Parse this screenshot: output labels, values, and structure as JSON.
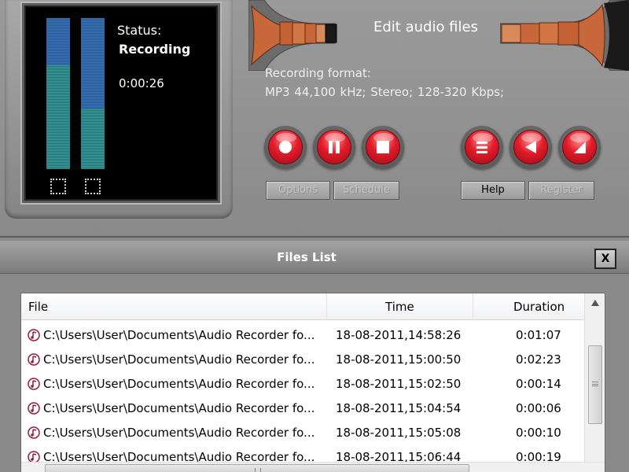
{
  "display": {
    "status_label": "Status:",
    "status_value": "Recording",
    "elapsed_time": "0:00:26",
    "vu_left_level": 0.69,
    "vu_right_level": 0.4
  },
  "header": {
    "title": "Edit audio files",
    "format_label": "Recording format:",
    "format_value": "MP3 44,100 kHz; Stereo;  128-320 Kbps;"
  },
  "transport": {
    "record_icon": "record-icon",
    "pause_icon": "pause-icon",
    "stop_icon": "stop-icon",
    "menu_icon": "menu-icon",
    "play_icon": "play-icon",
    "volume_icon": "volume-icon"
  },
  "buttons": {
    "options": "Options",
    "schedule": "Schedule",
    "help": "Help",
    "register": "Register"
  },
  "files_list": {
    "title": "Files List",
    "close_label": "X",
    "columns": {
      "file": "File",
      "time": "Time",
      "duration": "Duration"
    },
    "rows": [
      {
        "file": "C:\\Users\\User\\Documents\\Audio Recorder fo...",
        "time": "18-08-2011,14:58:26",
        "duration": "0:01:07"
      },
      {
        "file": "C:\\Users\\User\\Documents\\Audio Recorder fo...",
        "time": "18-08-2011,15:00:50",
        "duration": "0:02:23"
      },
      {
        "file": "C:\\Users\\User\\Documents\\Audio Recorder fo...",
        "time": "18-08-2011,15:02:50",
        "duration": "0:00:14"
      },
      {
        "file": "C:\\Users\\User\\Documents\\Audio Recorder fo...",
        "time": "18-08-2011,15:04:54",
        "duration": "0:00:06"
      },
      {
        "file": "C:\\Users\\User\\Documents\\Audio Recorder fo...",
        "time": "18-08-2011,15:05:08",
        "duration": "0:00:10"
      },
      {
        "file": "C:\\Users\\User\\Documents\\Audio Recorder fo...",
        "time": "18-08-2011,15:06:44",
        "duration": "0:00:19"
      }
    ]
  },
  "colors": {
    "red_button": "#e21b2a",
    "vu_teal": "#39a3a3",
    "vu_blue": "#3a75b8",
    "cone_orange": "#c8683a"
  }
}
